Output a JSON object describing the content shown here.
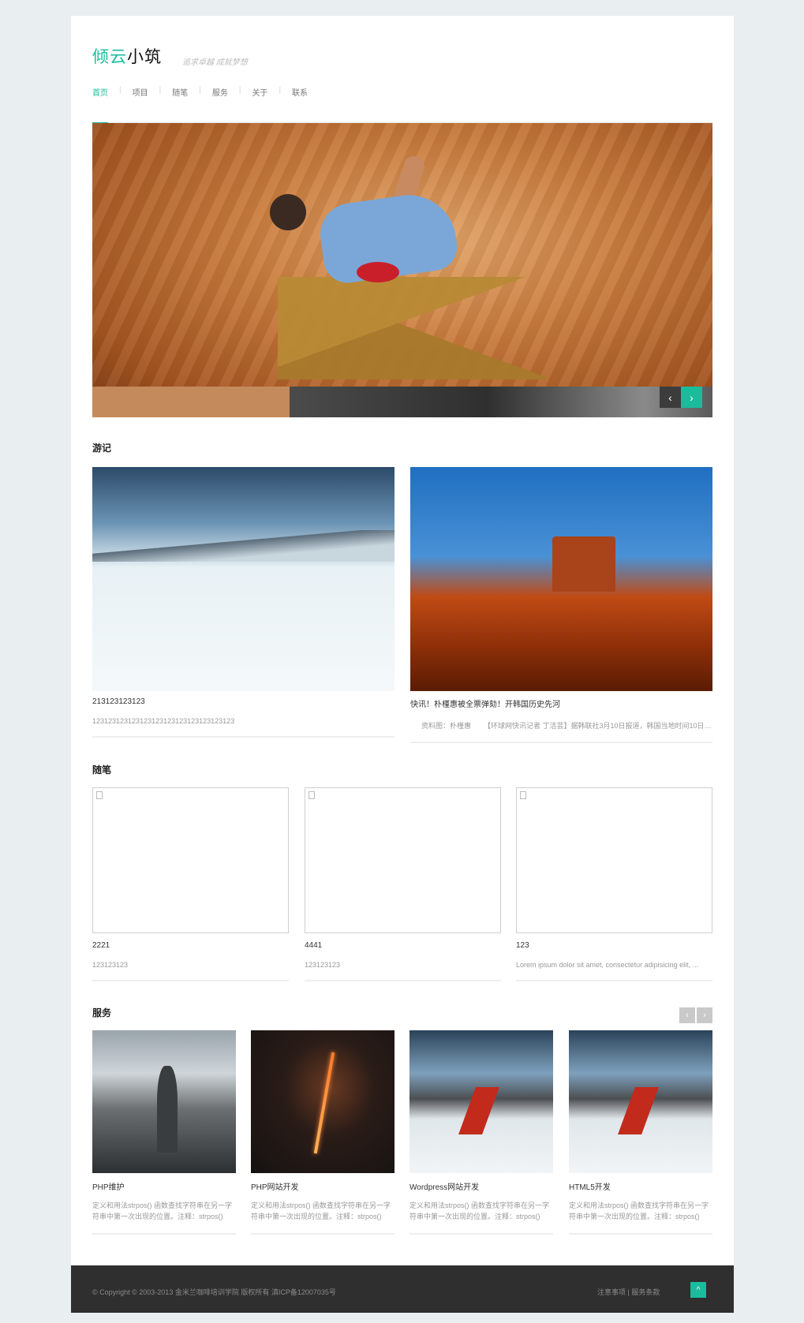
{
  "header": {
    "logo_part1": "倾云",
    "logo_part2": "小筑",
    "slogan": "追求卓越 成就梦想"
  },
  "nav": {
    "items": [
      {
        "label": "首页",
        "active": true
      },
      {
        "label": "项目"
      },
      {
        "label": "随笔"
      },
      {
        "label": "服务"
      },
      {
        "label": "关于"
      },
      {
        "label": "联系"
      }
    ],
    "separator": "|"
  },
  "hero": {
    "prev_icon": "chevron-left-icon",
    "next_icon": "chevron-right-icon",
    "prev_glyph": "‹",
    "next_glyph": "›"
  },
  "travel": {
    "title": "游记",
    "cards": [
      {
        "title": "213123123123",
        "desc": "123123123123123123123123123123123123"
      },
      {
        "title": "快讯！朴槿惠被全票弹劾！开韩国历史先河",
        "desc": "资料图：朴槿惠 　　【环球网快讯记者 丁洁芸】据韩联社3月10日报道，韩国当地时间10日上..."
      }
    ]
  },
  "essays": {
    "title": "随笔",
    "cards": [
      {
        "title": "2221",
        "desc": "123123123"
      },
      {
        "title": "4441",
        "desc": "123123123"
      },
      {
        "title": "123",
        "desc": "Lorem ipsum dolor sit amet, consectetur adipisicing elit, ..."
      }
    ]
  },
  "services": {
    "title": "服务",
    "prev_glyph": "‹",
    "next_glyph": "›",
    "cards": [
      {
        "title": "PHP维护",
        "desc": "定义和用法strpos() 函数查找字符串在另一字符串中第一次出现的位置。注释：strpos() 函..."
      },
      {
        "title": "PHP网站开发",
        "desc": "定义和用法strpos() 函数查找字符串在另一字符串中第一次出现的位置。注释：strpos() 函..."
      },
      {
        "title": "Wordpress网站开发",
        "desc": "定义和用法strpos() 函数查找字符串在另一字符串中第一次出现的位置。注释：strpos() 函..."
      },
      {
        "title": "HTML5开发",
        "desc": "定义和用法strpos() 函数查找字符串在另一字符串中第一次出现的位置。注释：strpos() 函..."
      }
    ]
  },
  "footer": {
    "copyright": "© Copyright © 2003-2013 金米兰咖啡培训学院 版权所有 滇ICP备12007035号",
    "link1": "注意事项",
    "sep": " | ",
    "link2": "服务条款",
    "totop_glyph": "^"
  },
  "colors": {
    "accent": "#1abc9c",
    "footer_bg": "#2f2f2f",
    "page_bg": "#e9eef1"
  }
}
